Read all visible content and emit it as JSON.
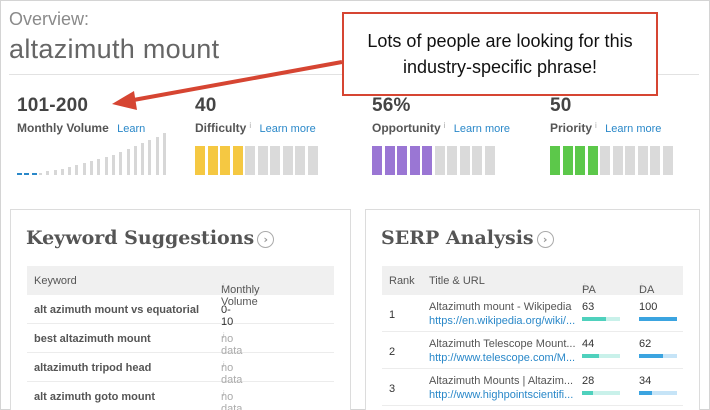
{
  "header": {
    "overview_label": "Overview:",
    "keyword": "altazimuth mount"
  },
  "callout": {
    "text": "Lots of people are looking for this industry-specific phrase!"
  },
  "metrics": {
    "volume": {
      "value": "101-200",
      "label": "Monthly Volume",
      "link": "Learn"
    },
    "difficulty": {
      "value": "40",
      "label": "Difficulty",
      "info": "i",
      "link": "Learn more",
      "filled_fraction": 0.4,
      "color": "#f5c842"
    },
    "opportunity": {
      "value": "56%",
      "label": "Opportunity",
      "info": "i",
      "link": "Learn more",
      "filled_fraction": 0.5,
      "color": "#9a76d4"
    },
    "priority": {
      "value": "50",
      "label": "Priority",
      "info": "i",
      "link": "Learn more",
      "filled_fraction": 0.4,
      "color": "#5cc84a"
    }
  },
  "keyword_suggestions": {
    "title": "Keyword Suggestions",
    "col_keyword": "Keyword",
    "col_volume": "Monthly Volume",
    "col_info": "i",
    "rows": [
      {
        "keyword": "alt azimuth mount vs equatorial",
        "volume": "0-10",
        "info": ""
      },
      {
        "keyword": "best altazimuth mount",
        "volume": "no data",
        "info": "i"
      },
      {
        "keyword": "altazimuth tripod head",
        "volume": "no data",
        "info": "i"
      },
      {
        "keyword": "alt azimuth goto mount",
        "volume": "no data",
        "info": "i"
      }
    ]
  },
  "serp_analysis": {
    "title": "SERP Analysis",
    "col_rank": "Rank",
    "col_title": "Title & URL",
    "col_pa": "PA",
    "col_da": "DA",
    "col_info": "i",
    "rows": [
      {
        "rank": "1",
        "title": "Altazimuth mount - Wikipedia",
        "url": "https://en.wikipedia.org/wiki/...",
        "pa": "63",
        "da": "100",
        "pa_fraction": 0.63,
        "da_fraction": 1.0
      },
      {
        "rank": "2",
        "title": "Altazimuth Telescope Mount...",
        "url": "http://www.telescope.com/M...",
        "pa": "44",
        "da": "62",
        "pa_fraction": 0.44,
        "da_fraction": 0.62
      },
      {
        "rank": "3",
        "title": "Altazimuth Mounts | Altazim...",
        "url": "http://www.highpointscientifi...",
        "pa": "28",
        "da": "34",
        "pa_fraction": 0.28,
        "da_fraction": 0.34
      }
    ]
  },
  "colors": {
    "link": "#2a88c9",
    "callout_border": "#d64532",
    "pa_bar": "#4fd1bd",
    "da_bar": "#3ba4e0",
    "block_empty": "#dadada"
  }
}
